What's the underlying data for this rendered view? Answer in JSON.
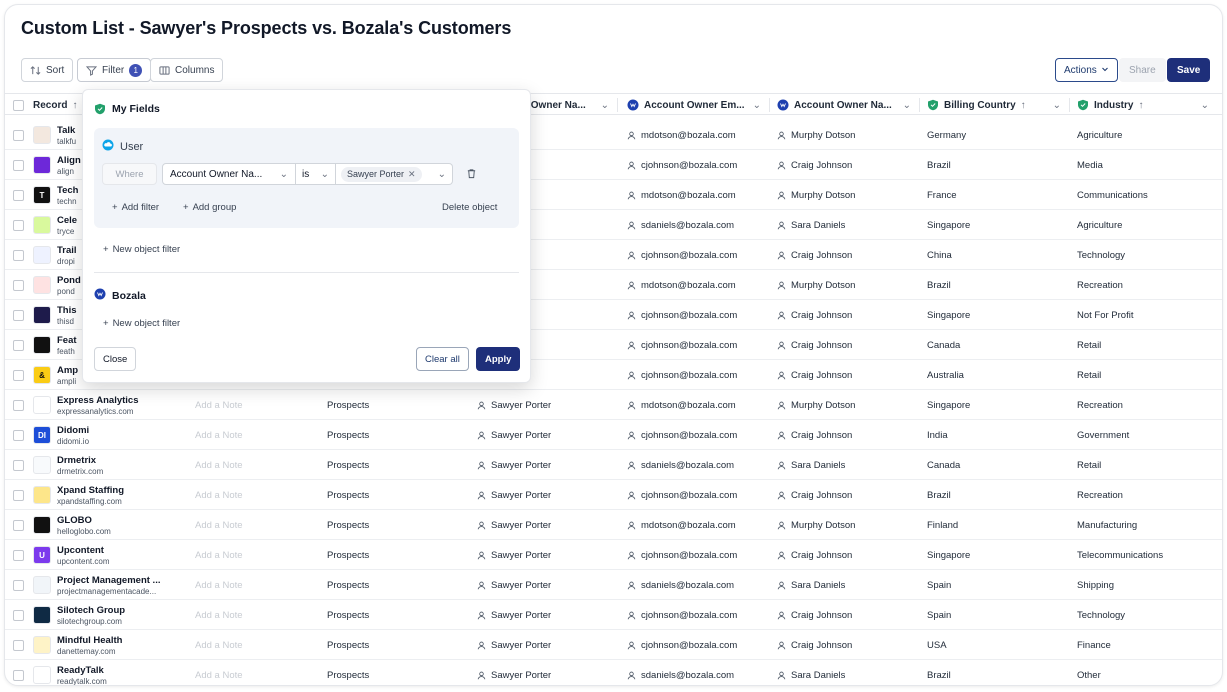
{
  "page_title": "Custom List - Sawyer's Prospects vs. Bozala's Customers",
  "toolbar": {
    "sort_label": "Sort",
    "filter_label": "Filter",
    "filter_count": "1",
    "columns_label": "Columns",
    "actions_label": "Actions",
    "share_label": "Share",
    "save_label": "Save"
  },
  "columns": {
    "record": "Record",
    "owner_name_1": "Account Owner Na...",
    "owner_email": "Account Owner Em...",
    "owner_name_2": "Account Owner Na...",
    "billing_country": "Billing Country",
    "industry": "Industry"
  },
  "colors": {
    "accent": "#1e2f7a",
    "badge": "#3f51b5",
    "shield_green": "#22a06b",
    "bozala_blue": "#1e40af"
  },
  "rows": [
    {
      "name": "Talk",
      "domain": "talkfu",
      "note": "",
      "list": "",
      "owner": "Porter",
      "email": "mdotson@bozala.com",
      "owner2": "Murphy Dotson",
      "country": "Germany",
      "industry": "Agriculture",
      "logo_text": "",
      "logo_color": "#f3e8df"
    },
    {
      "name": "Align",
      "domain": "align",
      "note": "",
      "list": "",
      "owner": "Porter",
      "email": "cjohnson@bozala.com",
      "owner2": "Craig Johnson",
      "country": "Brazil",
      "industry": "Media",
      "logo_text": "",
      "logo_color": "#6d28d9"
    },
    {
      "name": "Tech",
      "domain": "techn",
      "note": "",
      "list": "",
      "owner": "Porter",
      "email": "mdotson@bozala.com",
      "owner2": "Murphy Dotson",
      "country": "France",
      "industry": "Communications",
      "logo_text": "T",
      "logo_color": "#111111"
    },
    {
      "name": "Cele",
      "domain": "tryce",
      "note": "",
      "list": "",
      "owner": "Porter",
      "email": "sdaniels@bozala.com",
      "owner2": "Sara Daniels",
      "country": "Singapore",
      "industry": "Agriculture",
      "logo_text": "",
      "logo_color": "#d9f99d"
    },
    {
      "name": "Trail",
      "domain": "dropi",
      "note": "",
      "list": "",
      "owner": "Porter",
      "email": "cjohnson@bozala.com",
      "owner2": "Craig Johnson",
      "country": "China",
      "industry": "Technology",
      "logo_text": "",
      "logo_color": "#eef2ff"
    },
    {
      "name": "Pond",
      "domain": "pond",
      "note": "",
      "list": "",
      "owner": "Porter",
      "email": "mdotson@bozala.com",
      "owner2": "Murphy Dotson",
      "country": "Brazil",
      "industry": "Recreation",
      "logo_text": "",
      "logo_color": "#fee2e2"
    },
    {
      "name": "This",
      "domain": "thisd",
      "note": "",
      "list": "",
      "owner": "Porter",
      "email": "cjohnson@bozala.com",
      "owner2": "Craig Johnson",
      "country": "Singapore",
      "industry": "Not For Profit",
      "logo_text": "",
      "logo_color": "#1e1b4b"
    },
    {
      "name": "Feat",
      "domain": "feath",
      "note": "",
      "list": "",
      "owner": "Porter",
      "email": "cjohnson@bozala.com",
      "owner2": "Craig Johnson",
      "country": "Canada",
      "industry": "Retail",
      "logo_text": "",
      "logo_color": "#111111"
    },
    {
      "name": "Amp",
      "domain": "ampli",
      "note": "",
      "list": "",
      "owner": "Porter",
      "email": "cjohnson@bozala.com",
      "owner2": "Craig Johnson",
      "country": "Australia",
      "industry": "Retail",
      "logo_text": "&",
      "logo_color": "#facc15"
    },
    {
      "name": "Express Analytics",
      "domain": "expressanalytics.com",
      "note": "Add a Note",
      "list": "Prospects",
      "owner": "Sawyer Porter",
      "email": "mdotson@bozala.com",
      "owner2": "Murphy Dotson",
      "country": "Singapore",
      "industry": "Recreation",
      "logo_text": "",
      "logo_color": "#ffffff"
    },
    {
      "name": "Didomi",
      "domain": "didomi.io",
      "note": "Add a Note",
      "list": "Prospects",
      "owner": "Sawyer Porter",
      "email": "cjohnson@bozala.com",
      "owner2": "Craig Johnson",
      "country": "India",
      "industry": "Government",
      "logo_text": "DI",
      "logo_color": "#1d4ed8"
    },
    {
      "name": "Drmetrix",
      "domain": "drmetrix.com",
      "note": "Add a Note",
      "list": "Prospects",
      "owner": "Sawyer Porter",
      "email": "sdaniels@bozala.com",
      "owner2": "Sara Daniels",
      "country": "Canada",
      "industry": "Retail",
      "logo_text": "",
      "logo_color": "#f8fafc"
    },
    {
      "name": "Xpand Staffing",
      "domain": "xpandstaffing.com",
      "note": "Add a Note",
      "list": "Prospects",
      "owner": "Sawyer Porter",
      "email": "cjohnson@bozala.com",
      "owner2": "Craig Johnson",
      "country": "Brazil",
      "industry": "Recreation",
      "logo_text": "",
      "logo_color": "#fde68a"
    },
    {
      "name": "GLOBO",
      "domain": "helloglobo.com",
      "note": "Add a Note",
      "list": "Prospects",
      "owner": "Sawyer Porter",
      "email": "mdotson@bozala.com",
      "owner2": "Murphy Dotson",
      "country": "Finland",
      "industry": "Manufacturing",
      "logo_text": "",
      "logo_color": "#111111"
    },
    {
      "name": "Upcontent",
      "domain": "upcontent.com",
      "note": "Add a Note",
      "list": "Prospects",
      "owner": "Sawyer Porter",
      "email": "cjohnson@bozala.com",
      "owner2": "Craig Johnson",
      "country": "Singapore",
      "industry": "Telecommunications",
      "logo_text": "U",
      "logo_color": "#7c3aed"
    },
    {
      "name": "Project Management ...",
      "domain": "projectmanagementacade...",
      "note": "Add a Note",
      "list": "Prospects",
      "owner": "Sawyer Porter",
      "email": "sdaniels@bozala.com",
      "owner2": "Sara Daniels",
      "country": "Spain",
      "industry": "Shipping",
      "logo_text": "",
      "logo_color": "#f1f5f9"
    },
    {
      "name": "Silotech Group",
      "domain": "silotechgroup.com",
      "note": "Add a Note",
      "list": "Prospects",
      "owner": "Sawyer Porter",
      "email": "cjohnson@bozala.com",
      "owner2": "Craig Johnson",
      "country": "Spain",
      "industry": "Technology",
      "logo_text": "",
      "logo_color": "#0f2a44"
    },
    {
      "name": "Mindful Health",
      "domain": "danettemay.com",
      "note": "Add a Note",
      "list": "Prospects",
      "owner": "Sawyer Porter",
      "email": "cjohnson@bozala.com",
      "owner2": "Craig Johnson",
      "country": "USA",
      "industry": "Finance",
      "logo_text": "",
      "logo_color": "#fef3c7"
    },
    {
      "name": "ReadyTalk",
      "domain": "readytalk.com",
      "note": "Add a Note",
      "list": "Prospects",
      "owner": "Sawyer Porter",
      "email": "sdaniels@bozala.com",
      "owner2": "Sara Daniels",
      "country": "Brazil",
      "industry": "Other",
      "logo_text": "",
      "logo_color": "#ffffff"
    }
  ],
  "filter_popover": {
    "my_fields_title": "My Fields",
    "user_title": "User",
    "where_label": "Where",
    "field_value": "Account Owner Na...",
    "operator_value": "is",
    "chip_value": "Sawyer Porter",
    "add_filter": "Add filter",
    "add_group": "Add group",
    "delete_object": "Delete object",
    "new_object_filter_1": "New object filter",
    "bozala_title": "Bozala",
    "new_object_filter_2": "New object filter",
    "close_label": "Close",
    "clear_all_label": "Clear all",
    "apply_label": "Apply"
  }
}
